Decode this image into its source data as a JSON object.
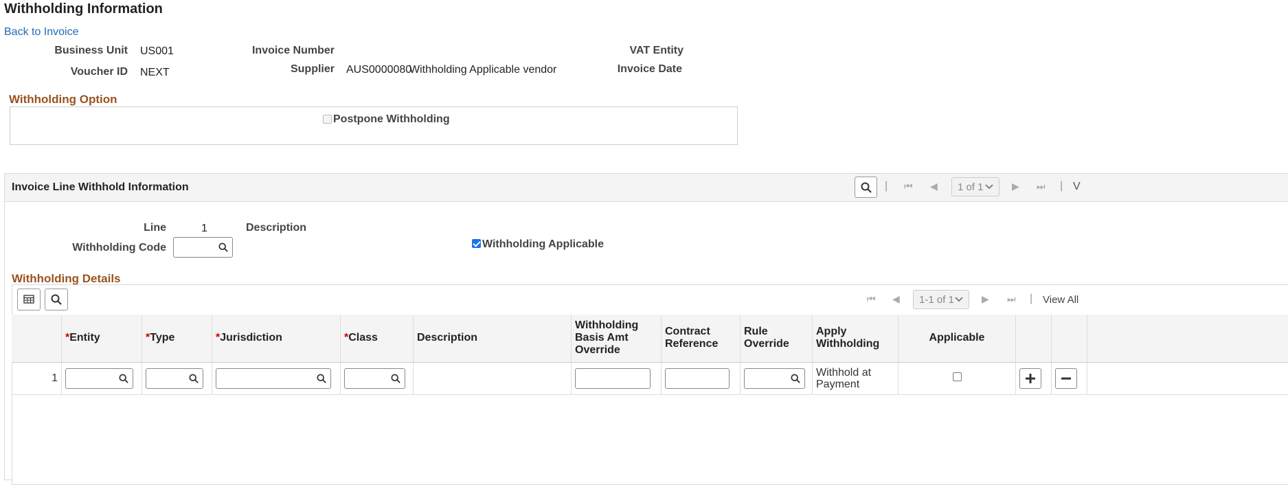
{
  "page": {
    "title": "Withholding Information",
    "back_link": "Back to Invoice"
  },
  "header": {
    "business_unit_label": "Business Unit",
    "business_unit": "US001",
    "invoice_number_label": "Invoice Number",
    "invoice_number": "",
    "vat_entity_label": "VAT Entity",
    "voucher_id_label": "Voucher ID",
    "voucher_id": "NEXT",
    "supplier_label": "Supplier",
    "supplier_id": "AUS0000080",
    "supplier_name": "Withholding Applicable vendor",
    "invoice_date_label": "Invoice Date"
  },
  "withholding_option": {
    "title": "Withholding Option",
    "postpone_label": "Postpone Withholding",
    "postpone_checked": false
  },
  "line_panel": {
    "title": "Invoice Line Withhold Information",
    "pager": "1 of 1",
    "view_all_partial": "V",
    "line_label": "Line",
    "line_value": "1",
    "description_label": "Description",
    "withholding_code_label": "Withholding Code",
    "withholding_code_value": "",
    "withholding_applicable_label": "Withholding Applicable",
    "withholding_applicable_checked": true
  },
  "details": {
    "title": "Withholding Details",
    "pager": "1-1 of 1",
    "view_all": "View All",
    "columns": {
      "entity": "Entity",
      "type": "Type",
      "jurisdiction": "Jurisdiction",
      "class": "Class",
      "description": "Description",
      "basis_override": "Withholding Basis Amt Override",
      "contract_reference": "Contract Reference",
      "rule_override": "Rule Override",
      "apply_withholding": "Apply Withholding",
      "applicable": "Applicable"
    },
    "required_mark": "*",
    "rows": [
      {
        "row_number": "1",
        "apply_withholding": "Withhold at Payment",
        "applicable_checked": false
      }
    ]
  },
  "icons": {
    "search": "search-icon",
    "grid_personalize": "grid-personalize-icon",
    "first": "first-page-icon",
    "prev": "previous-page-icon",
    "next": "next-page-icon",
    "last": "last-page-icon",
    "add": "add-row-icon",
    "delete": "delete-row-icon"
  },
  "colors": {
    "link": "#1f6bb5",
    "section_title": "#9a5220",
    "checkbox_checked": "#1a73e8"
  }
}
